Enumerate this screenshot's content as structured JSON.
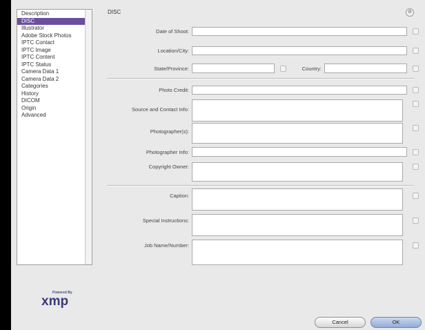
{
  "sidebar": {
    "items": [
      {
        "label": "Description",
        "selected": false
      },
      {
        "label": "DISC",
        "selected": true
      },
      {
        "label": "Illustrator",
        "selected": false
      },
      {
        "label": "Adobe Stock Photos",
        "selected": false
      },
      {
        "label": "IPTC Contact",
        "selected": false
      },
      {
        "label": "IPTC Image",
        "selected": false
      },
      {
        "label": "IPTC Content",
        "selected": false
      },
      {
        "label": "IPTC Status",
        "selected": false
      },
      {
        "label": "Camera Data 1",
        "selected": false
      },
      {
        "label": "Camera Data 2",
        "selected": false
      },
      {
        "label": "Categories",
        "selected": false
      },
      {
        "label": "History",
        "selected": false
      },
      {
        "label": "DICOM",
        "selected": false
      },
      {
        "label": "Origin",
        "selected": false
      },
      {
        "label": "Advanced",
        "selected": false
      }
    ]
  },
  "panel": {
    "title": "DISC",
    "fields": {
      "date_of_shoot": {
        "label": "Date of Shoot:",
        "value": ""
      },
      "location_city": {
        "label": "Location/City:",
        "value": ""
      },
      "state_province": {
        "label": "State/Province:",
        "value": ""
      },
      "country": {
        "label": "Country:",
        "value": ""
      },
      "photo_credit": {
        "label": "Photo Credit:",
        "value": ""
      },
      "source_contact": {
        "label": "Source and Contact Info:",
        "value": ""
      },
      "photographers": {
        "label": "Photographer(s):",
        "value": ""
      },
      "photographer_info": {
        "label": "Photographer Info:",
        "value": ""
      },
      "copyright_owner": {
        "label": "Copyright Owner:",
        "value": ""
      },
      "caption": {
        "label": "Caption:",
        "value": ""
      },
      "special_instructions": {
        "label": "Special Instructions:",
        "value": ""
      },
      "job_name": {
        "label": "Job Name/Number:",
        "value": ""
      }
    }
  },
  "logo": {
    "small": "Powered By",
    "main": "xmp"
  },
  "buttons": {
    "cancel": "Cancel",
    "ok": "OK"
  },
  "colors": {
    "selection": "#6a4f9e",
    "accent": "#39397a"
  }
}
